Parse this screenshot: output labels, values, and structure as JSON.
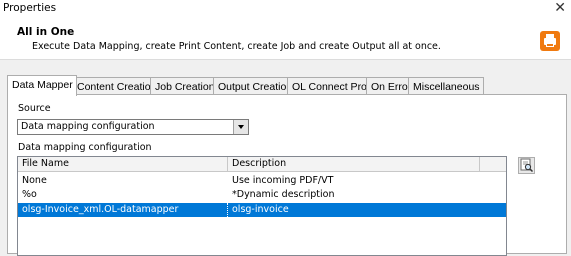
{
  "window": {
    "title": "Properties",
    "close_glyph": "✕"
  },
  "header": {
    "title": "All in One",
    "description": "Execute Data Mapping, create Print Content, create Job and create Output all at once.",
    "icon": "printer-icon",
    "icon_color": "#f07a10"
  },
  "tabs": [
    {
      "label": "Data Mapper",
      "active": true
    },
    {
      "label": "Content Creation",
      "active": false
    },
    {
      "label": "Job Creation",
      "active": false
    },
    {
      "label": "Output Creation",
      "active": false
    },
    {
      "label": "OL Connect Proxy",
      "active": false
    },
    {
      "label": "On Error",
      "active": false
    },
    {
      "label": "Miscellaneous",
      "active": false
    }
  ],
  "source": {
    "label": "Source",
    "value": "Data mapping configuration"
  },
  "config_list": {
    "label": "Data mapping configuration",
    "columns": [
      "File Name",
      "Description"
    ],
    "rows": [
      {
        "file_name": "None",
        "description": "Use incoming PDF/VT",
        "selected": false
      },
      {
        "file_name": "%o",
        "description": "*Dynamic description",
        "selected": false
      },
      {
        "file_name": "olsg-Invoice_xml.OL-datamapper",
        "description": "olsg-invoice",
        "selected": true
      }
    ],
    "selection_color": "#0078d7"
  },
  "side_button": {
    "icon": "browse-config-icon"
  }
}
